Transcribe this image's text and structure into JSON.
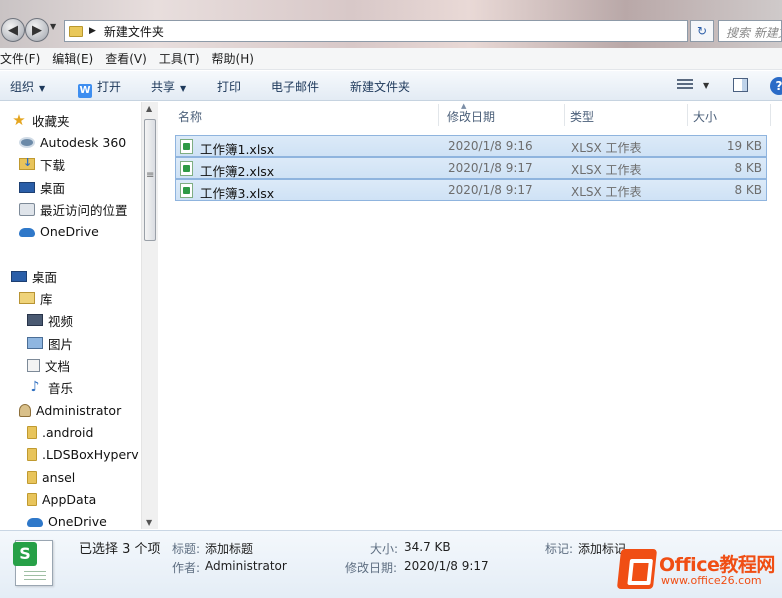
{
  "address": {
    "path": "新建文件夹",
    "search_placeholder": "搜索 新建文件夹"
  },
  "menu": [
    "文件(F)",
    "编辑(E)",
    "查看(V)",
    "工具(T)",
    "帮助(H)"
  ],
  "toolbar": {
    "organize": "组织",
    "open": "打开",
    "share": "共享",
    "print": "打印",
    "email": "电子邮件",
    "new_folder": "新建文件夹"
  },
  "nav": {
    "favorites": "收藏夹",
    "autodesk": "Autodesk 360",
    "downloads": "下载",
    "desktop_fav": "桌面",
    "recent": "最近访问的位置",
    "onedrive_fav": "OneDrive",
    "desktop": "桌面",
    "libraries": "库",
    "videos": "视频",
    "pictures": "图片",
    "documents": "文档",
    "music": "音乐",
    "admin": "Administrator",
    "android": ".android",
    "ldsbox": ".LDSBoxHyperv",
    "ansel": "ansel",
    "appdata": "AppData",
    "onedrive": "OneDrive"
  },
  "columns": {
    "name": "名称",
    "date": "修改日期",
    "type": "类型",
    "size": "大小"
  },
  "files": [
    {
      "name": "工作簿1.xlsx",
      "date": "2020/1/8 9:16",
      "type": "XLSX 工作表",
      "size": "19 KB"
    },
    {
      "name": "工作簿2.xlsx",
      "date": "2020/1/8 9:17",
      "type": "XLSX 工作表",
      "size": "8 KB"
    },
    {
      "name": "工作簿3.xlsx",
      "date": "2020/1/8 9:17",
      "type": "XLSX 工作表",
      "size": "8 KB"
    }
  ],
  "details": {
    "selected": "已选择 3 个项",
    "title_label": "标题:",
    "title_value": "添加标题",
    "author_label": "作者:",
    "author_value": "Administrator",
    "size_label": "大小:",
    "size_value": "34.7 KB",
    "modified_label": "修改日期:",
    "modified_value": "2020/1/8 9:17",
    "tags_label": "标记:",
    "tags_value": "添加标记"
  },
  "watermark": {
    "brand": "Office教程网",
    "url": "www.office26.com"
  }
}
